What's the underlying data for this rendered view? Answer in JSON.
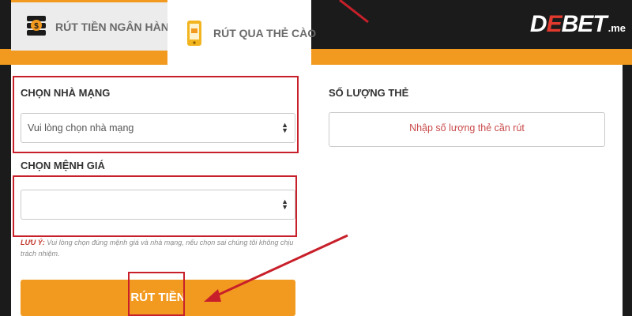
{
  "tabs": {
    "bank": {
      "label": "RÚT TIỀN NGÂN HÀNG",
      "icon": "coin-stack-icon"
    },
    "card": {
      "label": "RÚT QUA THẺ CÀO",
      "icon": "phone-card-icon"
    }
  },
  "logo": {
    "main_d": "D",
    "main_e": "E",
    "main_rest": "BET",
    "suffix": ".me"
  },
  "form": {
    "network_label": "CHỌN NHÀ MẠNG",
    "network_value": "Vui lòng chọn nhà mạng",
    "denomination_label": "CHỌN MỆNH GIÁ",
    "denomination_value": "",
    "quantity_label": "SỐ LƯỢNG THẺ",
    "quantity_placeholder": "Nhập số lượng thẻ cần rút",
    "note_prefix": "LƯU Ý:",
    "note_line1": "Vui lòng chọn đúng mệnh giá và nhà mạng, nếu chọn sai chúng tôi không chịu",
    "note_line2": "trách nhiệm.",
    "submit_label": "RÚT TIỀN"
  },
  "colors": {
    "accent": "#f29a1f",
    "highlight": "#c8202a",
    "background": "#1b1b1b"
  }
}
